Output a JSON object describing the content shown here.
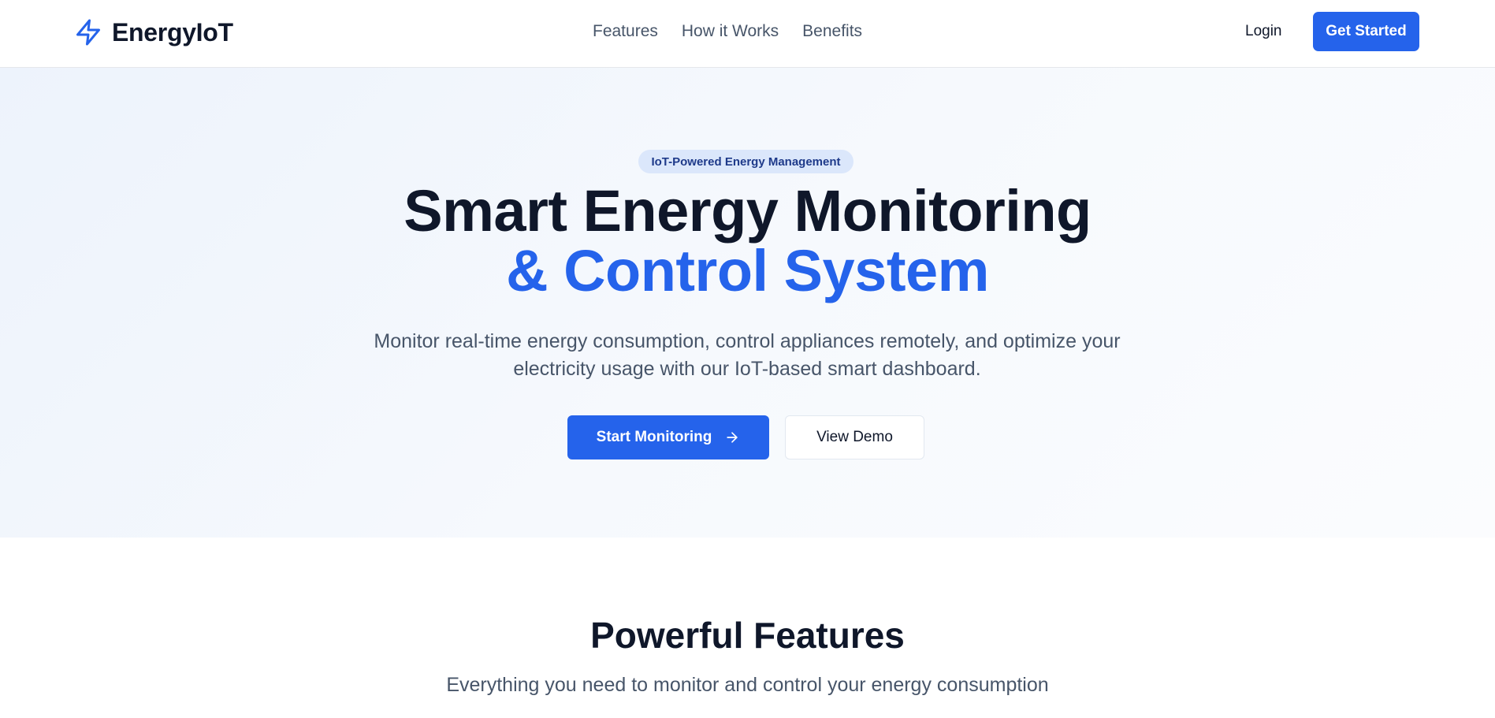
{
  "brand": {
    "name": "EnergyIoT",
    "icon": "lightning-bolt-icon",
    "accent_color": "#2563eb"
  },
  "nav": {
    "items": [
      {
        "label": "Features"
      },
      {
        "label": "How it Works"
      },
      {
        "label": "Benefits"
      }
    ],
    "login_label": "Login",
    "get_started_label": "Get Started"
  },
  "hero": {
    "badge": "IoT-Powered Energy Management",
    "title_line1": "Smart Energy Monitoring",
    "title_line2": "& Control System",
    "subtitle": "Monitor real-time energy consumption, control appliances remotely, and optimize your electricity usage with our IoT-based smart dashboard.",
    "primary_button": "Start Monitoring",
    "primary_icon": "arrow-right-icon",
    "secondary_button": "View Demo"
  },
  "features": {
    "title": "Powerful Features",
    "subtitle": "Everything you need to monitor and control your energy consumption"
  }
}
